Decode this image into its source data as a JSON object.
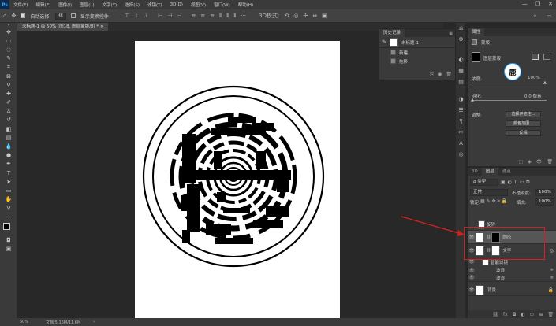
{
  "app": {
    "logo": "Ps"
  },
  "menu": [
    "文件(F)",
    "编辑(E)",
    "图像(I)",
    "图层(L)",
    "文字(Y)",
    "选择(S)",
    "滤镜(T)",
    "3D(D)",
    "视图(V)",
    "窗口(W)",
    "帮助(H)"
  ],
  "window_controls": [
    "—",
    "❐",
    "✕"
  ],
  "options": {
    "auto_select_label": "自动选择:",
    "auto_select_value": "组",
    "show_transform_label": "显示变换控件"
  },
  "document_tab": "未标题-1 @ 50% (图18, 图层蒙版/8) * ×",
  "status": {
    "zoom": "50%",
    "doc": "文档:5.16M/11.6M"
  },
  "history": {
    "title": "历史记录",
    "rows": [
      "未标题-1",
      "新建",
      "拖移"
    ]
  },
  "properties": {
    "title": "属性",
    "mask_label": "蒙版",
    "layer_mask_label": "图层蒙版",
    "density_label": "浓度:",
    "density_value": "100%",
    "feather_label": "羽化:",
    "feather_value": "0.0 像素",
    "refine_label": "调整:",
    "buttons": [
      "选择并遮住...",
      "颜色范围...",
      "反相"
    ]
  },
  "layers": {
    "tabs": [
      "3D",
      "图层",
      "通道"
    ],
    "filter_label": "ρ 类型",
    "blend_mode": "正常",
    "opacity_label": "不透明度:",
    "opacity_value": "100%",
    "lock_label": "锁定:",
    "fill_label": "填充:",
    "fill_value": "100%",
    "rows": [
      {
        "name": "旋转"
      },
      {
        "name": "圆形"
      },
      {
        "name": "文字"
      },
      {
        "name": "智能滤镜"
      },
      {
        "name": "波浪"
      },
      {
        "name": "波浪"
      },
      {
        "name": "背景"
      }
    ]
  },
  "colors": {
    "accent": "#31a8ff",
    "annotation": "#d62020"
  }
}
